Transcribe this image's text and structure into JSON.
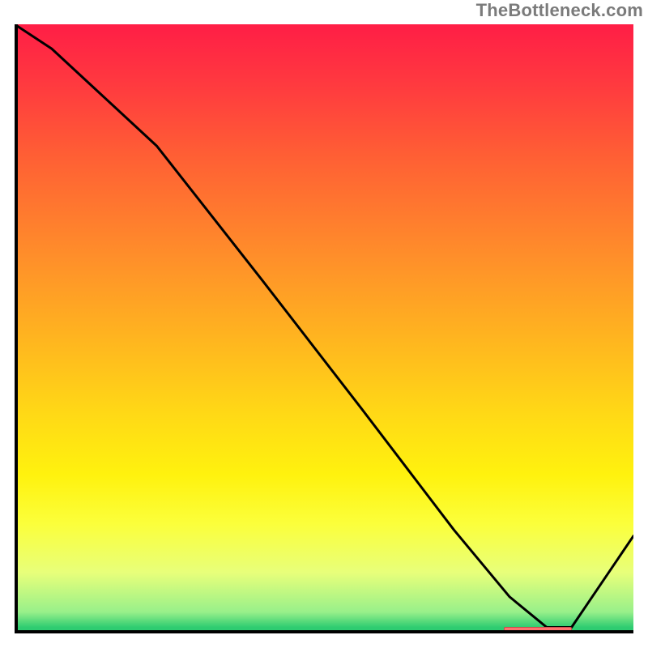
{
  "watermark": "TheBottleneck.com",
  "chart_data": {
    "type": "line",
    "title": "",
    "xlabel": "",
    "ylabel": "",
    "xlim": [
      0,
      100
    ],
    "ylim": [
      0,
      100
    ],
    "grid": false,
    "legend": false,
    "series": [
      {
        "name": "bottleneck-curve",
        "x": [
          0,
          6,
          23,
          40,
          56,
          71,
          80,
          86,
          90,
          100
        ],
        "values": [
          100,
          96,
          80,
          58,
          37,
          17,
          6,
          1,
          1,
          16
        ]
      }
    ],
    "markers": [
      {
        "name": "optimal-range",
        "x_start": 79,
        "x_end": 90,
        "y": 0.7
      }
    ],
    "colors": {
      "curve": "#000000",
      "marker": "#ff726f",
      "gradient_top": "#ff1e46",
      "gradient_bottom": "#2ecc71"
    }
  }
}
